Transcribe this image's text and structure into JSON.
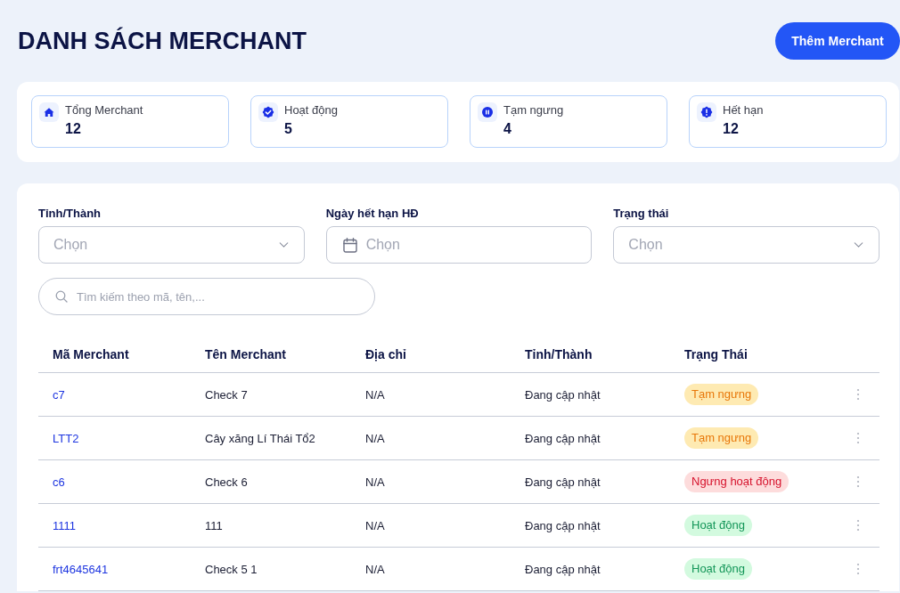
{
  "header": {
    "title": "DANH SÁCH MERCHANT",
    "add_button": "Thêm Merchant"
  },
  "stats": [
    {
      "kind": "total",
      "label": "Tổng Merchant",
      "value": "12"
    },
    {
      "kind": "active",
      "label": "Hoạt động",
      "value": "5"
    },
    {
      "kind": "paused",
      "label": "Tạm ngưng",
      "value": "4"
    },
    {
      "kind": "expired",
      "label": "Hết hạn",
      "value": "12"
    }
  ],
  "filters": [
    {
      "kind": "select",
      "label": "Tỉnh/Thành",
      "placeholder": "Chọn"
    },
    {
      "kind": "date",
      "label": "Ngày hết hạn HĐ",
      "placeholder": "Chọn"
    },
    {
      "kind": "select",
      "label": "Trạng thái",
      "placeholder": "Chọn"
    }
  ],
  "search": {
    "placeholder": "Tìm kiếm theo mã, tên,..."
  },
  "table": {
    "columns": [
      "Mã Merchant",
      "Tên Merchant",
      "Địa chỉ",
      "Tỉnh/Thành",
      "Trạng Thái"
    ],
    "rows": [
      {
        "code": "c7",
        "name": "Check 7",
        "address": "N/A",
        "province": "Đang cập nhật",
        "status": {
          "kind": "paused",
          "label": "Tạm ngưng"
        }
      },
      {
        "code": "LTT2",
        "name": "Cây xăng Lí Thái Tổ2",
        "address": "N/A",
        "province": "Đang cập nhật",
        "status": {
          "kind": "paused",
          "label": "Tạm ngưng"
        }
      },
      {
        "code": "c6",
        "name": "Check 6",
        "address": "N/A",
        "province": "Đang cập nhật",
        "status": {
          "kind": "stopped",
          "label": "Ngưng hoạt động"
        }
      },
      {
        "code": "1111",
        "name": "111",
        "address": "N/A",
        "province": "Đang cập nhật",
        "status": {
          "kind": "active",
          "label": "Hoạt động"
        }
      },
      {
        "code": "frt4645641",
        "name": "Check 5 1",
        "address": "N/A",
        "province": "Đang cập nhật",
        "status": {
          "kind": "active",
          "label": "Hoạt động"
        }
      }
    ]
  }
}
